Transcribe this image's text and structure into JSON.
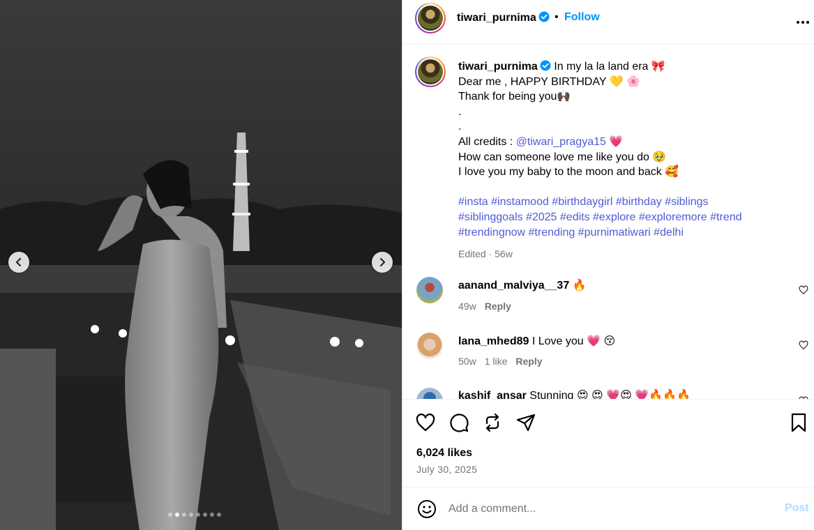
{
  "post": {
    "username": "tiwari_purnima",
    "dot": "•",
    "follow_label": "Follow",
    "more_label": "•••"
  },
  "caption": {
    "username": "tiwari_purnima",
    "lines": [
      "In my la la land era 🎀",
      "Dear me , HAPPY BIRTHDAY 💛 🌸",
      "Thank for being you🙌🏿",
      ".",
      "."
    ],
    "credits_prefix": "All credits : ",
    "credits_handle": "@tiwari_pragya15",
    "credits_suffix": " 💗",
    "line_love1": "How can someone love me like you do 🥹",
    "line_love2": "I love you my baby to the moon and back 🥰",
    "hashtags_1": "#insta #instamood #birthdaygirl #birthday #siblings",
    "hashtags_2": "#siblinggoals #2025 #edits #explore #exploremore #trend",
    "hashtags_3": "#trendingnow #trending #purnimatiwari #delhi",
    "meta": "Edited · 56w"
  },
  "comments": [
    {
      "username": "aanand_malviya__37",
      "text": " 🔥",
      "time": "49w",
      "likes": "",
      "reply": "Reply"
    },
    {
      "username": "lana_mhed89",
      "text": " I Love you 💗 😚",
      "time": "50w",
      "likes": "1 like",
      "reply": "Reply"
    },
    {
      "username": "kashif_ansar",
      "text": " Stunning 😍 😍 💗😍 💗🔥🔥🔥",
      "time": "",
      "likes": "",
      "reply": ""
    }
  ],
  "stats": {
    "likes": "6,024 likes",
    "date": "July 30, 2025"
  },
  "add_comment": {
    "placeholder": "Add a comment...",
    "post_label": "Post"
  },
  "media": {
    "slide_count": 8,
    "active_slide": 2
  },
  "colors": {
    "link": "#4f5bd5",
    "follow": "#0095f6",
    "verified": "#0095f6",
    "muted": "#737373",
    "post_disabled": "#b3dbff"
  }
}
